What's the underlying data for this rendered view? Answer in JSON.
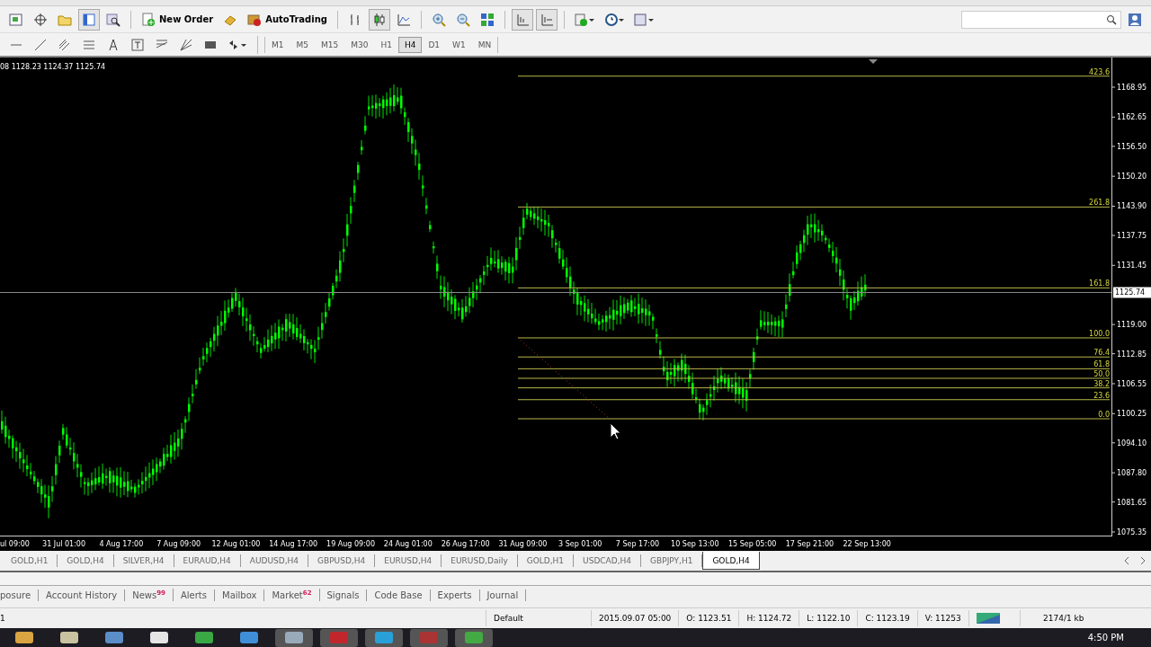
{
  "toolbar": {
    "new_order": "New Order",
    "autotrading": "AutoTrading"
  },
  "timeframes": [
    {
      "label": "M1",
      "selected": false
    },
    {
      "label": "M5",
      "selected": false
    },
    {
      "label": "M15",
      "selected": false
    },
    {
      "label": "M30",
      "selected": false
    },
    {
      "label": "H1",
      "selected": false
    },
    {
      "label": "H4",
      "selected": true
    },
    {
      "label": "D1",
      "selected": false
    },
    {
      "label": "W1",
      "selected": false
    },
    {
      "label": "MN",
      "selected": false
    }
  ],
  "chart": {
    "ohlc_header": "08 1128.23 1124.37 1125.74",
    "current_price": "1125.74",
    "price_axis": [
      "1168.95",
      "1162.65",
      "1156.50",
      "1150.20",
      "1143.90",
      "1137.75",
      "1131.45",
      "1119.00",
      "1112.85",
      "1106.55",
      "1100.25",
      "1094.10",
      "1087.80",
      "1081.65",
      "1075.35"
    ],
    "fib_levels": [
      {
        "label": "423.6"
      },
      {
        "label": "261.8"
      },
      {
        "label": "161.8"
      },
      {
        "label": "100.0"
      },
      {
        "label": "76.4"
      },
      {
        "label": "61.8"
      },
      {
        "label": "50.0"
      },
      {
        "label": "38.2"
      },
      {
        "label": "23.6"
      },
      {
        "label": "0.0"
      }
    ],
    "time_axis": [
      "ul 09:00",
      "31 Jul 01:00",
      "4 Aug 17:00",
      "7 Aug 09:00",
      "12 Aug 01:00",
      "14 Aug 17:00",
      "19 Aug 09:00",
      "24 Aug 01:00",
      "26 Aug 17:00",
      "31 Aug 09:00",
      "3 Sep 01:00",
      "7 Sep 17:00",
      "10 Sep 13:00",
      "15 Sep 05:00",
      "17 Sep 21:00",
      "22 Sep 13:00"
    ]
  },
  "chart_tabs": [
    {
      "label": "GOLD,H1",
      "selected": false
    },
    {
      "label": "GOLD,H4",
      "selected": false
    },
    {
      "label": "SILVER,H4",
      "selected": false
    },
    {
      "label": "EURAUD,H4",
      "selected": false
    },
    {
      "label": "AUDUSD,H4",
      "selected": false
    },
    {
      "label": "GBPUSD,H4",
      "selected": false
    },
    {
      "label": "EURUSD,H4",
      "selected": false
    },
    {
      "label": "EURUSD,Daily",
      "selected": false
    },
    {
      "label": "GOLD,H1",
      "selected": false
    },
    {
      "label": "USDCAD,H4",
      "selected": false
    },
    {
      "label": "GBPJPY,H1",
      "selected": false
    },
    {
      "label": "GOLD,H4",
      "selected": true
    }
  ],
  "terminal_tabs": [
    {
      "label": "posure"
    },
    {
      "label": "Account History"
    },
    {
      "label": "News",
      "badge": "99"
    },
    {
      "label": "Alerts"
    },
    {
      "label": "Mailbox"
    },
    {
      "label": "Market",
      "badge": "62"
    },
    {
      "label": "Signals"
    },
    {
      "label": "Code Base"
    },
    {
      "label": "Experts"
    },
    {
      "label": "Journal"
    }
  ],
  "status_bar": {
    "help": "1",
    "profile": "Default",
    "time": "2015.09.07 05:00",
    "open": "O: 1123.51",
    "high": "H: 1124.72",
    "low": "L: 1122.10",
    "close": "C: 1123.19",
    "volume": "V: 11253",
    "traffic": "2174/1 kb"
  },
  "taskbar": {
    "clock": "4:50 PM"
  }
}
